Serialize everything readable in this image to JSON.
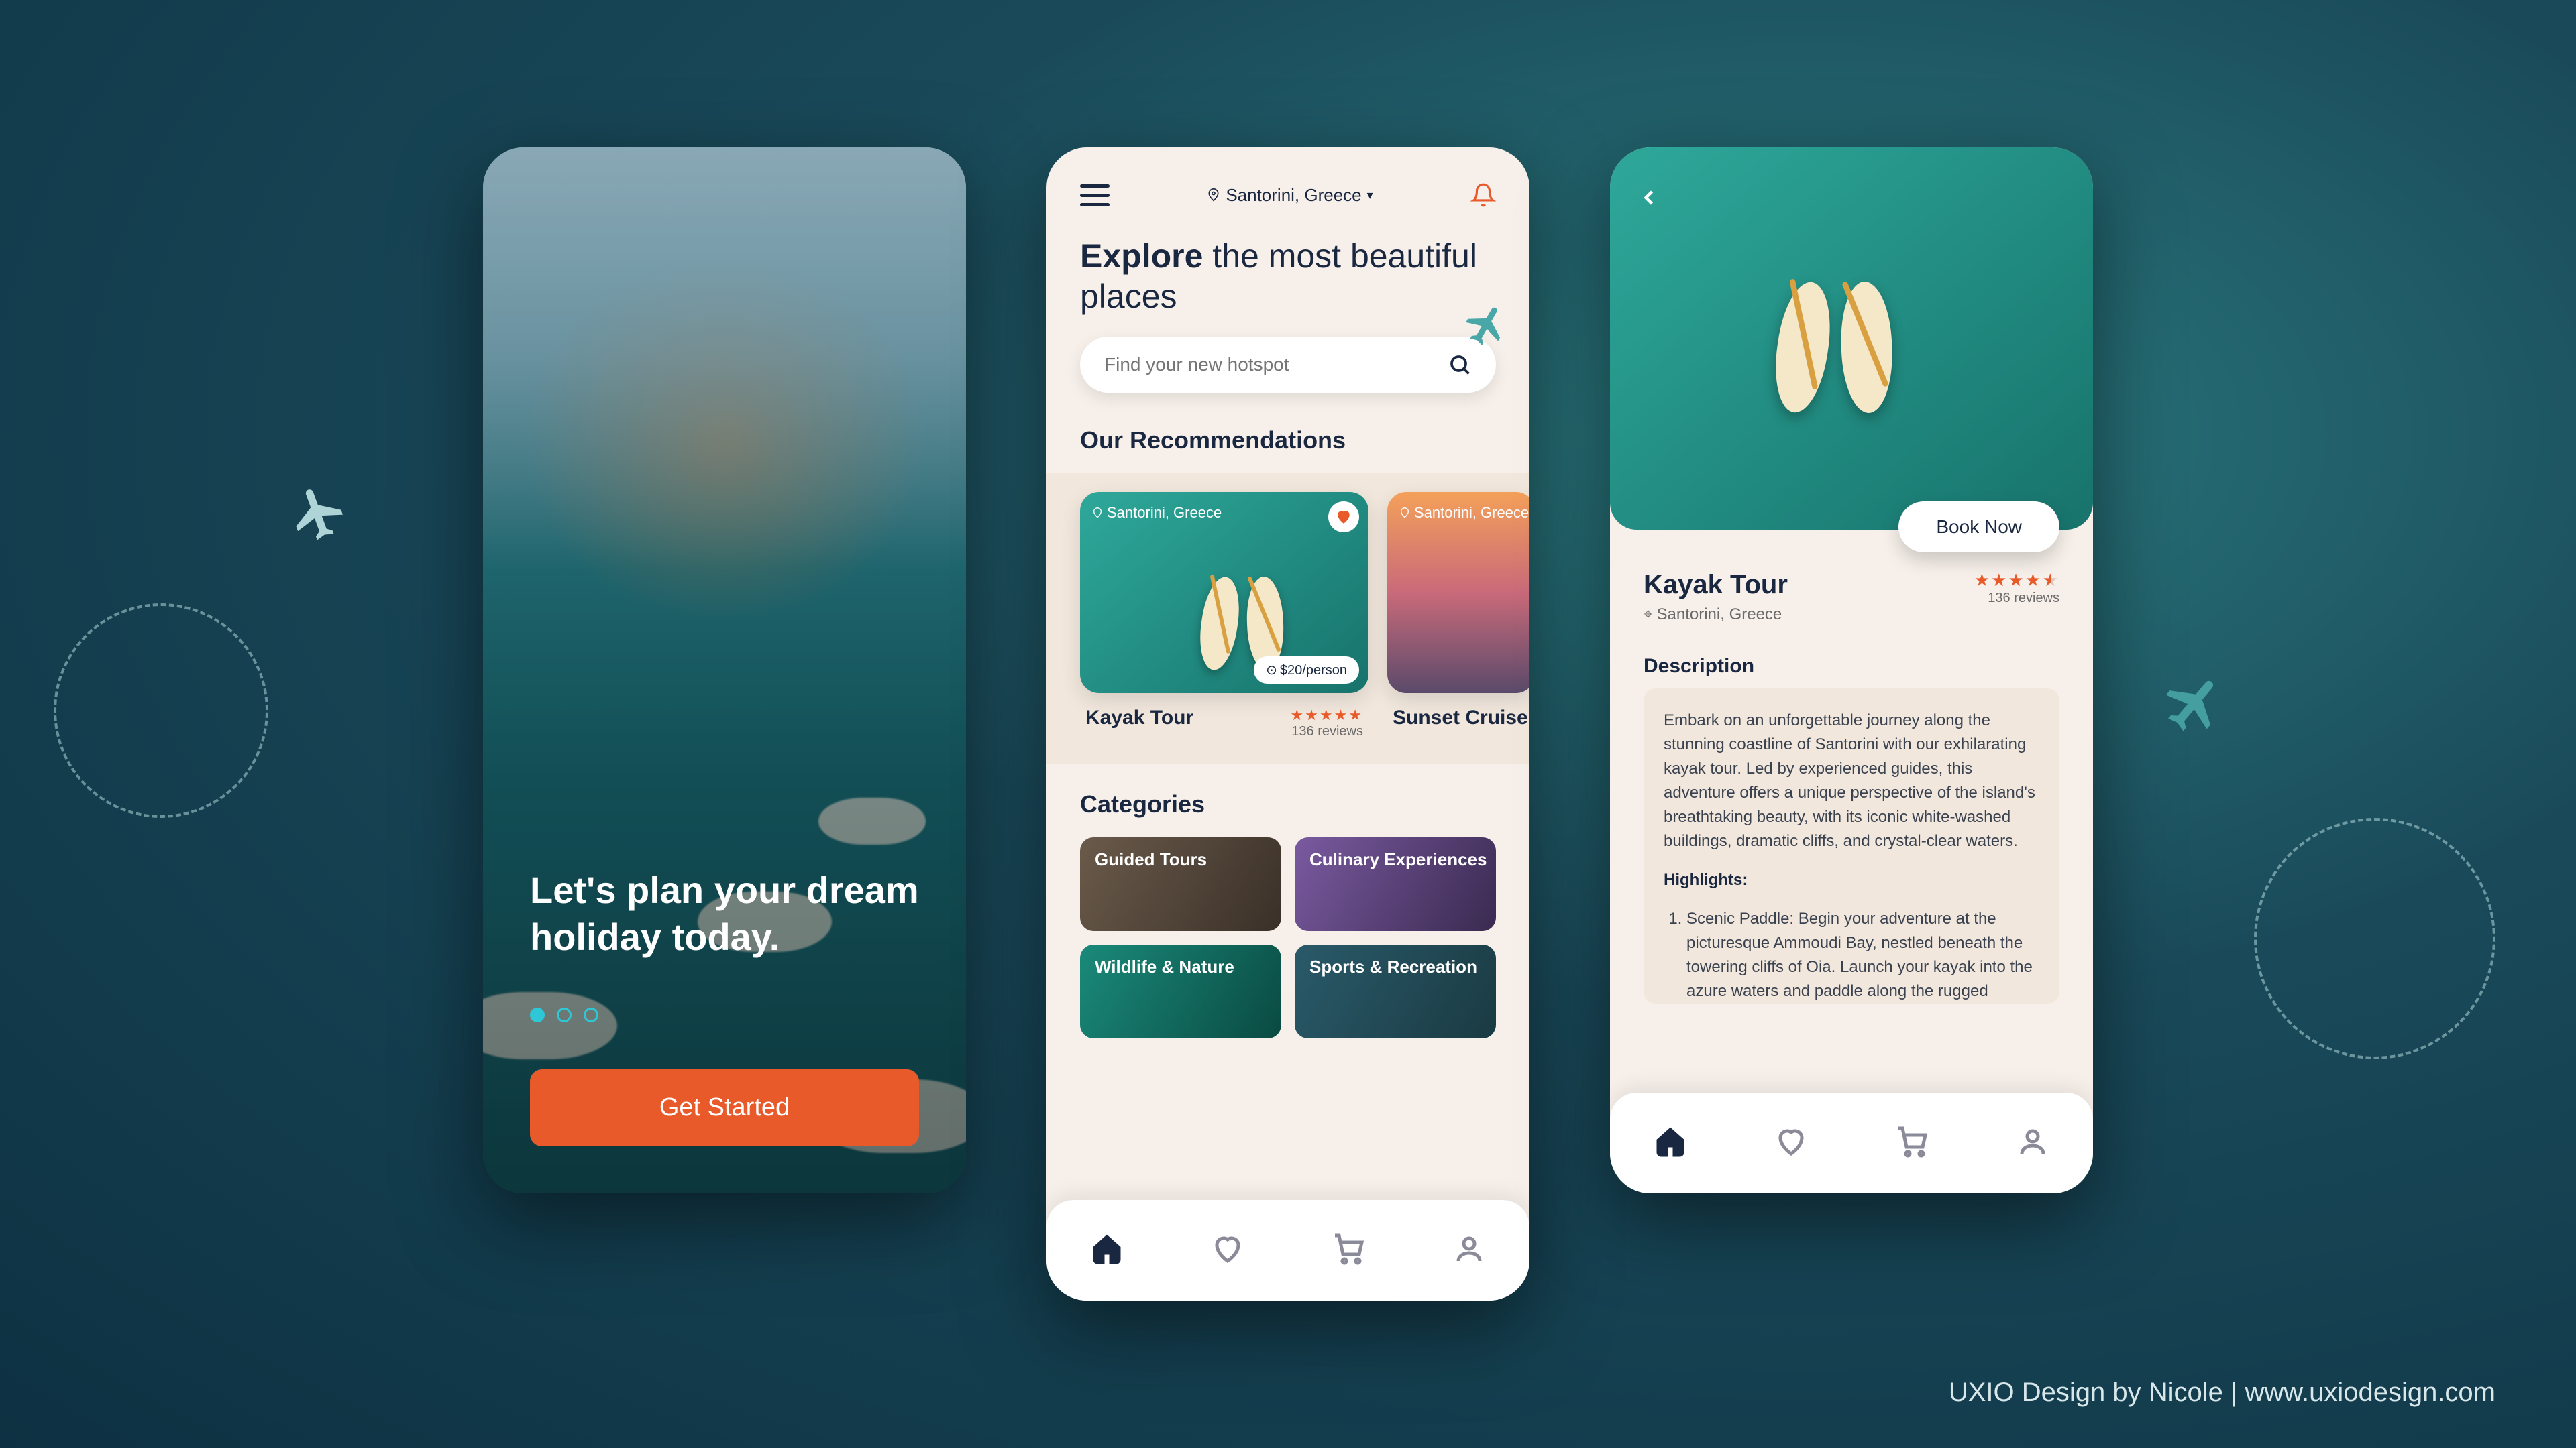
{
  "onboarding": {
    "headline": "Let's plan your dream holiday today.",
    "cta": "Get Started"
  },
  "explore": {
    "location": "Santorini, Greece",
    "headline_bold": "Explore",
    "headline_rest": " the most beautiful places",
    "search_placeholder": "Find your new hotspot",
    "recommendations_heading": "Our Recommendations",
    "cards": [
      {
        "location": "Santorini, Greece",
        "price": "$20/person",
        "title": "Kayak Tour",
        "reviews": "136 reviews"
      },
      {
        "location": "Santorini, Greece",
        "title": "Sunset Cruise"
      }
    ],
    "categories_heading": "Categories",
    "categories": [
      "Guided Tours",
      "Culinary Experiences",
      "Wildlife & Nature",
      "Sports & Recreation"
    ]
  },
  "detail": {
    "book_cta": "Book Now",
    "title": "Kayak Tour",
    "location": "Santorini, Greece",
    "reviews": "136 reviews",
    "description_heading": "Description",
    "description_body": "Embark on an unforgettable journey along the stunning coastline of Santorini with our exhilarating kayak tour. Led by experienced guides, this adventure offers a unique perspective of the island's breathtaking beauty, with its iconic white-washed buildings, dramatic cliffs, and crystal-clear waters.",
    "highlights_heading": "Highlights:",
    "highlight_1": "Scenic Paddle: Begin your adventure at the picturesque Ammoudi Bay, nestled beneath the towering cliffs of Oia. Launch your kayak into the azure waters and paddle along the rugged coastline, soaking in panoramic"
  },
  "credit": "UXIO Design by Nicole | www.uxiodesign.com"
}
